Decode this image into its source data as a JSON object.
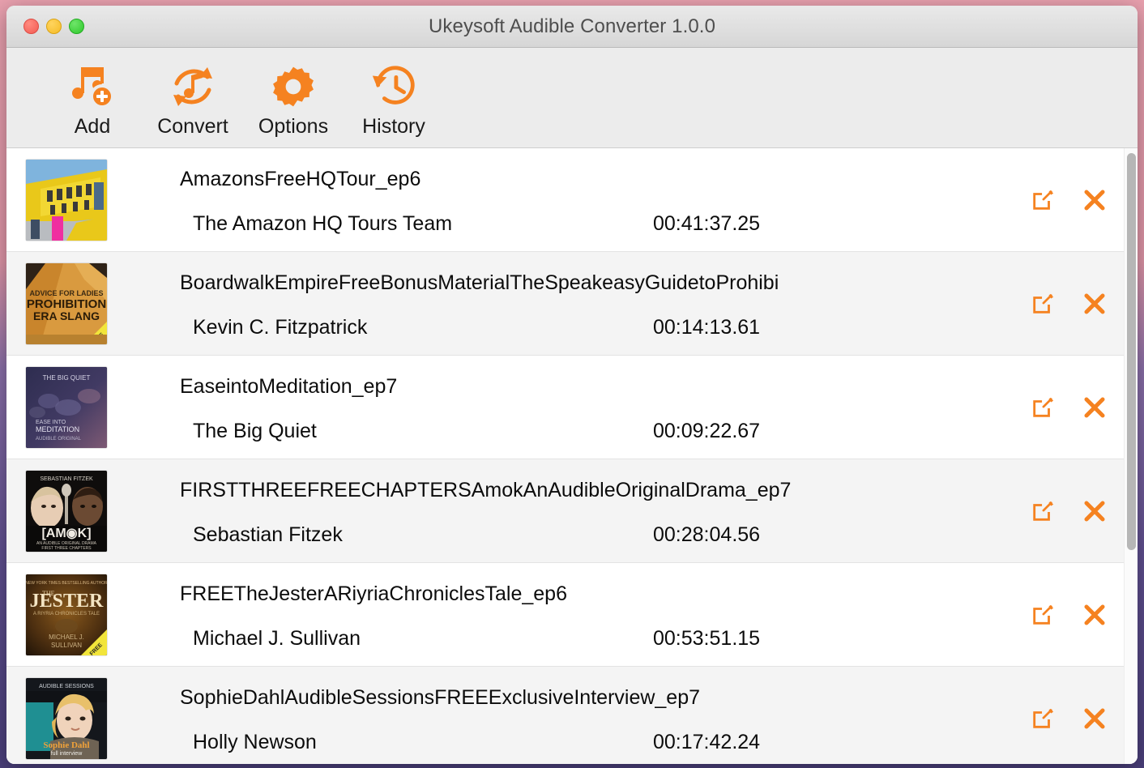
{
  "window": {
    "title": "Ukeysoft Audible Converter 1.0.0",
    "traffic_lights": {
      "close_label": "close",
      "minimize_label": "minimize",
      "zoom_label": "zoom"
    }
  },
  "theme": {
    "accent": "#F58220",
    "row_bg": "#FFFFFF",
    "row_bg_alt": "#F4F4F4",
    "toolbar_bg": "#ECECEC",
    "titlebar_bg": "#DEDEDE",
    "text": "#0C0C0C",
    "title_text": "#4E4E4E"
  },
  "toolbar": {
    "buttons": [
      {
        "label": "Add",
        "icon": "music-note-add-icon"
      },
      {
        "label": "Convert",
        "icon": "convert-refresh-icon"
      },
      {
        "label": "Options",
        "icon": "gear-icon"
      },
      {
        "label": "History",
        "icon": "clock-history-icon"
      }
    ]
  },
  "list": {
    "actions": {
      "edit_icon": "edit-pencil-square-icon",
      "remove_icon": "close-x-icon"
    },
    "items": [
      {
        "title": "AmazonsFreeHQTour_ep6",
        "author": "The Amazon HQ Tours Team",
        "duration": "00:41:37.25",
        "cover": "amazon-hq-tour-cover"
      },
      {
        "title": "BoardwalkEmpireFreeBonusMaterialTheSpeakeasyGuidetoProhibi",
        "author": "Kevin C. Fitzpatrick",
        "duration": "00:14:13.61",
        "cover": "prohibition-era-slang-cover"
      },
      {
        "title": "EaseintoMeditation_ep7",
        "author": "The Big Quiet",
        "duration": "00:09:22.67",
        "cover": "ease-into-meditation-cover"
      },
      {
        "title": "FIRSTTHREEFREECHAPTERSAmokAnAudibleOriginalDrama_ep7",
        "author": "Sebastian Fitzek",
        "duration": "00:28:04.56",
        "cover": "amok-cover"
      },
      {
        "title": "FREETheJesterARiyriaChroniclesTale_ep6",
        "author": "Michael J. Sullivan",
        "duration": "00:53:51.15",
        "cover": "the-jester-cover"
      },
      {
        "title": "SophieDahlAudibleSessionsFREEExclusiveInterview_ep7",
        "author": "Holly Newson",
        "duration": "00:17:42.24",
        "cover": "sophie-dahl-cover"
      }
    ]
  },
  "scrollbar": {
    "orientation": "vertical",
    "thumb_position_percent": 0
  }
}
